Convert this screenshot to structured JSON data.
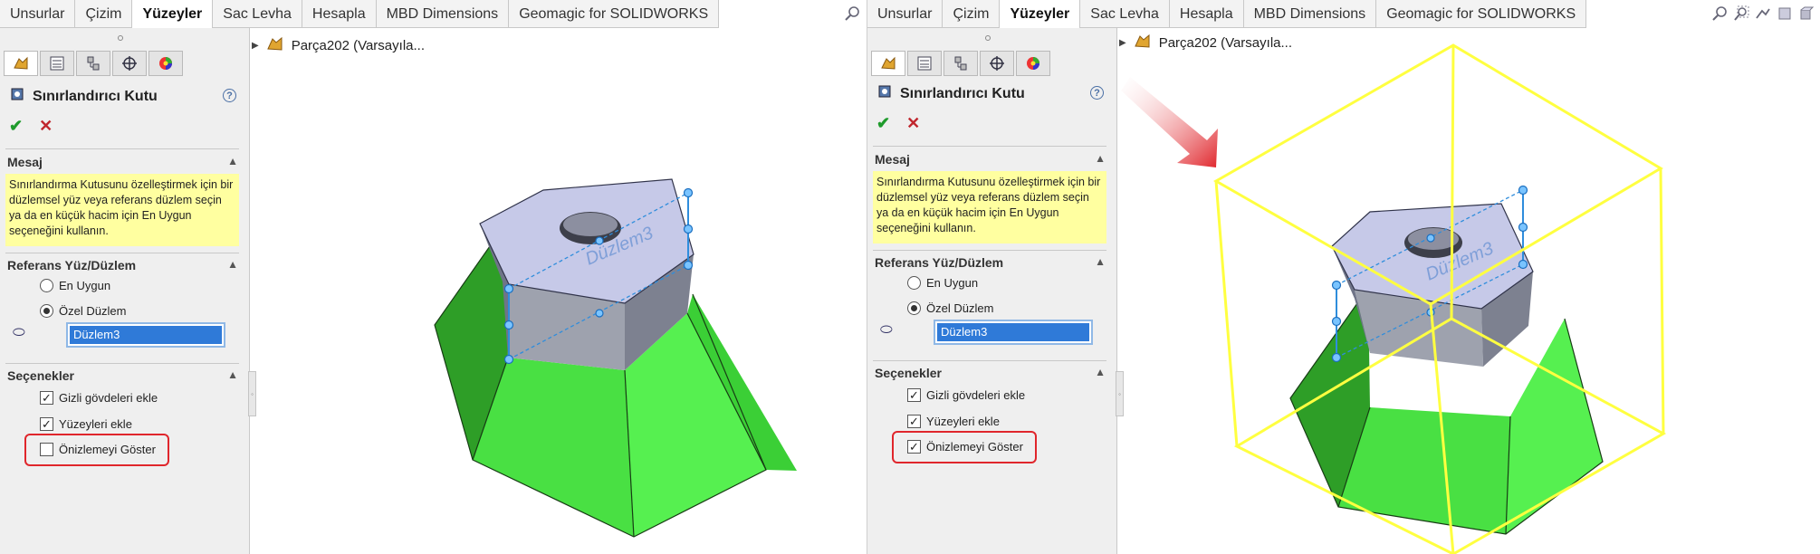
{
  "tabs": [
    "Unsurlar",
    "Çizim",
    "Yüzeyler",
    "Sac Levha",
    "Hesapla",
    "MBD Dimensions",
    "Geomagic for SOLIDWORKS"
  ],
  "active_tab": "Yüzeyler",
  "feature": {
    "title": "Sınırlandırıcı Kutu",
    "help_symbol": "?",
    "ok_symbol": "✔",
    "cancel_symbol": "✕"
  },
  "sections": {
    "message": {
      "title": "Mesaj",
      "text": "Sınırlandırma Kutusunu özelleştirmek için bir düzlemsel yüz veya referans düzlem seçin ya da en küçük hacim için En Uygun seçeneğini kullanın."
    },
    "reference": {
      "title": "Referans Yüz/Düzlem",
      "radio_best": "En Uygun",
      "radio_custom": "Özel Düzlem",
      "selected_value": "Düzlem3"
    },
    "options": {
      "title": "Seçenekler",
      "include_hidden": "Gizli gövdeleri ekle",
      "include_surfaces": "Yüzeyleri ekle",
      "show_preview": "Önizlemeyi Göster"
    }
  },
  "tree": {
    "item": "Parça202  (Varsayıla..."
  },
  "model": {
    "plane_label": "Düzlem3"
  },
  "states": {
    "left": {
      "show_preview_checked": false
    },
    "right": {
      "show_preview_checked": true
    }
  },
  "colors": {
    "face_green": "#3fd23a",
    "hex_top": "#c6c9e8",
    "bounding_box": "#ffff40",
    "highlight_red": "#e0262c",
    "selection_blue": "#2f7ad8"
  }
}
